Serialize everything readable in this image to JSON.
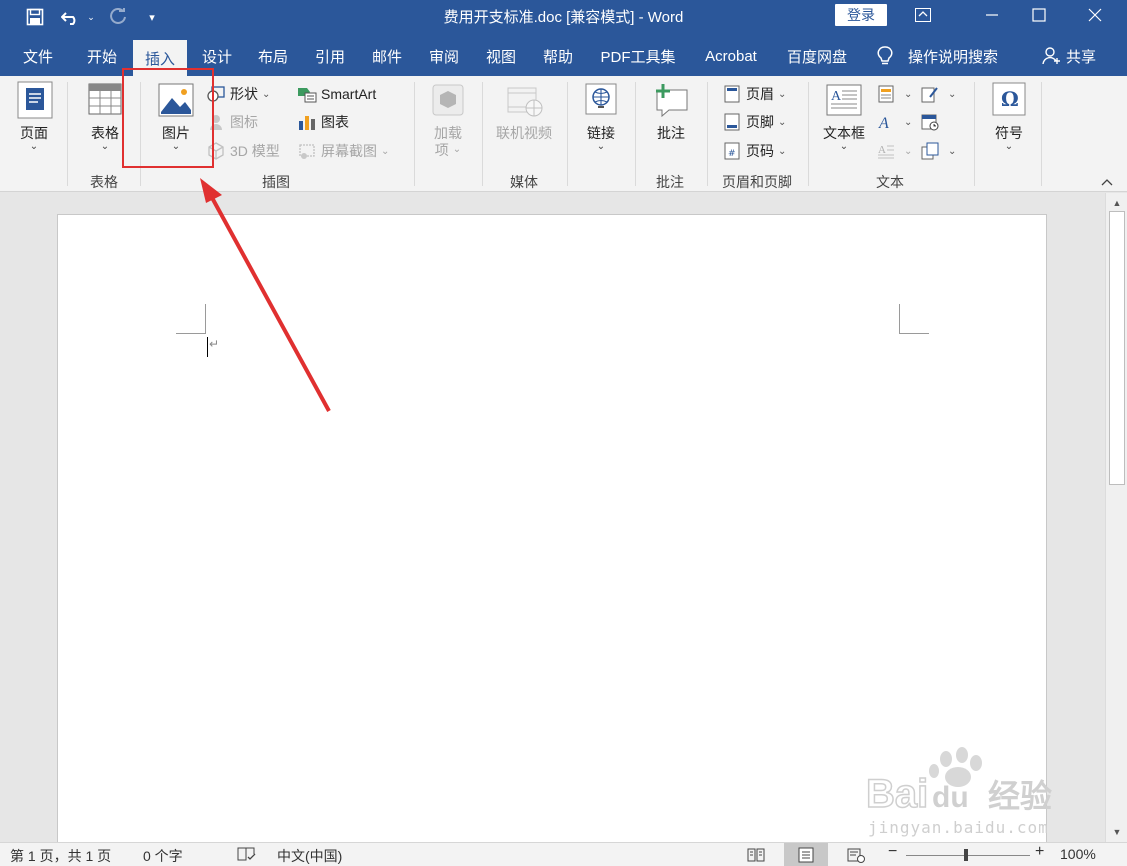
{
  "window": {
    "title": "费用开支标准.doc [兼容模式]  -  Word",
    "login": "登录"
  },
  "tabs": [
    "文件",
    "开始",
    "插入",
    "设计",
    "布局",
    "引用",
    "邮件",
    "审阅",
    "视图",
    "帮助",
    "PDF工具集",
    "Acrobat",
    "百度网盘"
  ],
  "active_tab": "插入",
  "tell_me": "操作说明搜索",
  "share": "共享",
  "ribbon": {
    "pages": {
      "label": "页面"
    },
    "tables": {
      "button": "表格",
      "group": "表格"
    },
    "illustrations": {
      "group": "插图",
      "picture": "图片",
      "shapes": "形状",
      "icons": "图标",
      "model3d": "3D 模型",
      "smartart": "SmartArt",
      "chart": "图表",
      "screenshot": "屏幕截图"
    },
    "addins": {
      "label1": "加载",
      "label2": "项"
    },
    "media": {
      "button": "联机视频",
      "group": "媒体"
    },
    "links": {
      "button": "链接"
    },
    "comments": {
      "button": "批注",
      "group": "批注"
    },
    "header_footer": {
      "header": "页眉",
      "footer": "页脚",
      "page_number": "页码",
      "group": "页眉和页脚"
    },
    "text": {
      "textbox": "文本框",
      "group": "文本"
    },
    "symbols": {
      "button": "符号"
    }
  },
  "statusbar": {
    "page": "第 1 页，共 1 页",
    "words": "0 个字",
    "language": "中文(中国)",
    "zoom": "100%",
    "zoom_minus": "−",
    "zoom_plus": "+"
  },
  "watermark": {
    "brand": "Bai",
    "brand2": "du",
    "brand_cn": "经验",
    "url": "jingyan.baidu.com"
  },
  "colors": {
    "title_bar": "#2b579a",
    "ribbon": "#f3f3f3",
    "annotation": "#e03030"
  }
}
